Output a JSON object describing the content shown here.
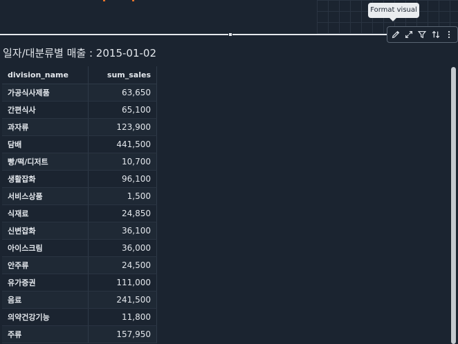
{
  "tooltip": {
    "text": "Format visual"
  },
  "toolbar": {
    "buttons": [
      {
        "icon": "pencil-icon"
      },
      {
        "icon": "expand-icon"
      },
      {
        "icon": "filter-icon"
      },
      {
        "icon": "sort-icon"
      },
      {
        "icon": "more-icon"
      }
    ]
  },
  "visual": {
    "title": "일자/대분류별 매출 : 2015-01-02"
  },
  "table": {
    "columns": [
      "division_name",
      "sum_sales"
    ],
    "rows": [
      [
        "가공식사제품",
        "63,650"
      ],
      [
        "간편식사",
        "65,100"
      ],
      [
        "과자류",
        "123,900"
      ],
      [
        "담배",
        "441,500"
      ],
      [
        "빵/떡/디저트",
        "10,700"
      ],
      [
        "생활잡화",
        "96,100"
      ],
      [
        "서비스상품",
        "1,500"
      ],
      [
        "식재료",
        "24,850"
      ],
      [
        "신변잡화",
        "36,100"
      ],
      [
        "아이스크림",
        "36,000"
      ],
      [
        "안주류",
        "24,500"
      ],
      [
        "유가증권",
        "111,000"
      ],
      [
        "음료",
        "241,500"
      ],
      [
        "의약건강기능",
        "11,800"
      ],
      [
        "주류",
        "157,950"
      ]
    ]
  },
  "colors": {
    "background": "#1b2430",
    "accent": "#e8742a",
    "text": "#e3e7ec"
  }
}
